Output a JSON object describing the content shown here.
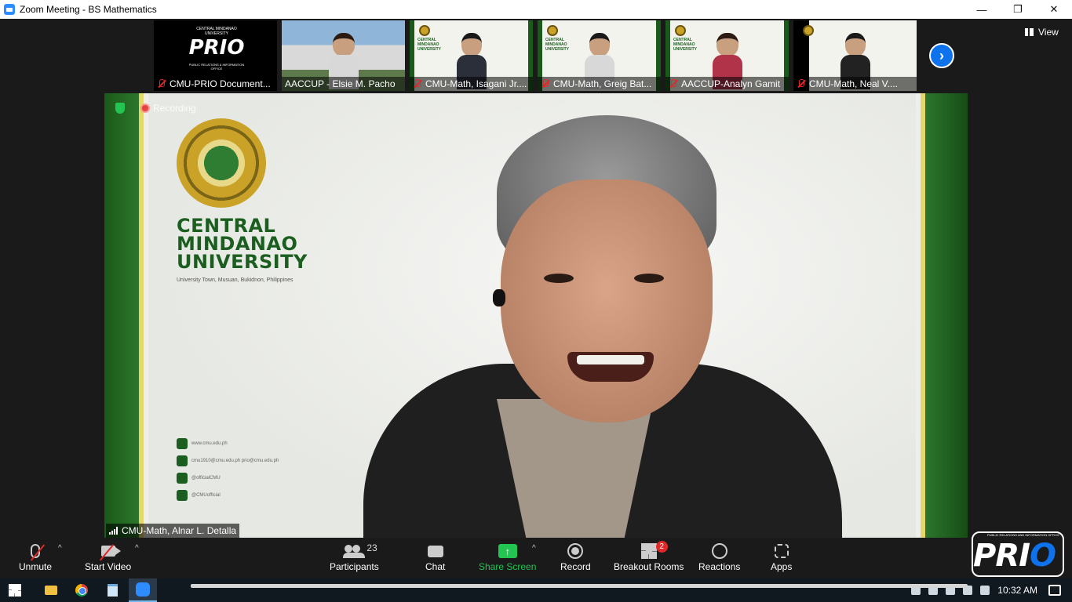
{
  "window": {
    "title": "Zoom Meeting - BS Mathematics",
    "controls": [
      "—",
      "❐",
      "✕"
    ]
  },
  "thumbnails": [
    {
      "name": "CMU-PRIO Document...",
      "type": "logo",
      "logo_text": "PRIO",
      "logo_top": "CENTRAL MINDANAO UNIVERSITY",
      "logo_bottom": "PUBLIC RELATIONS & INFORMATION OFFICE"
    },
    {
      "name": "AACCUP - Elsie M. Pacho",
      "type": "photo"
    },
    {
      "name": "CMU-Math, Isagani Jr....",
      "type": "cmu"
    },
    {
      "name": "CMU-Math, Greig Bat...",
      "type": "cmu"
    },
    {
      "name": "AACCUP-Analyn Gamit",
      "type": "cmu"
    },
    {
      "name": "CMU-Math, Neal V....",
      "type": "cmu"
    }
  ],
  "thumb_uni_text": "CENTRAL MINDANAO UNIVERSITY",
  "view_label": "View",
  "speaker": {
    "name": "CMU-Math, Alnar L. Detalla",
    "recording_label": "Recording",
    "background": {
      "university": [
        "CENTRAL",
        "MINDANAO",
        "UNIVERSITY"
      ],
      "address": "University Town, Musuan, Bukidnon, Philippines",
      "contacts": [
        "www.cmu.edu.ph",
        "cmu1910@cmu.edu.ph prio@cmu.edu.ph",
        "@officialCMU",
        "@CMUofficial"
      ]
    }
  },
  "toolbar": {
    "unmute": "Unmute",
    "start_video": "Start Video",
    "participants": "Participants",
    "participants_count": "23",
    "chat": "Chat",
    "share_screen": "Share Screen",
    "record": "Record",
    "breakout_rooms": "Breakout Rooms",
    "breakout_badge": "2",
    "reactions": "Reactions",
    "apps": "Apps"
  },
  "watermark": {
    "text_p": "PR",
    "text_i": "I",
    "text_o": "O",
    "small": "PUBLIC RELATIONS AND INFORMATION OFFICE"
  },
  "taskbar": {
    "time": "10:32 AM"
  },
  "colors": {
    "zoom_blue": "#2d8cff",
    "share_green": "#23c552",
    "mute_red": "#e02828",
    "cmu_green": "#1b5e20"
  }
}
